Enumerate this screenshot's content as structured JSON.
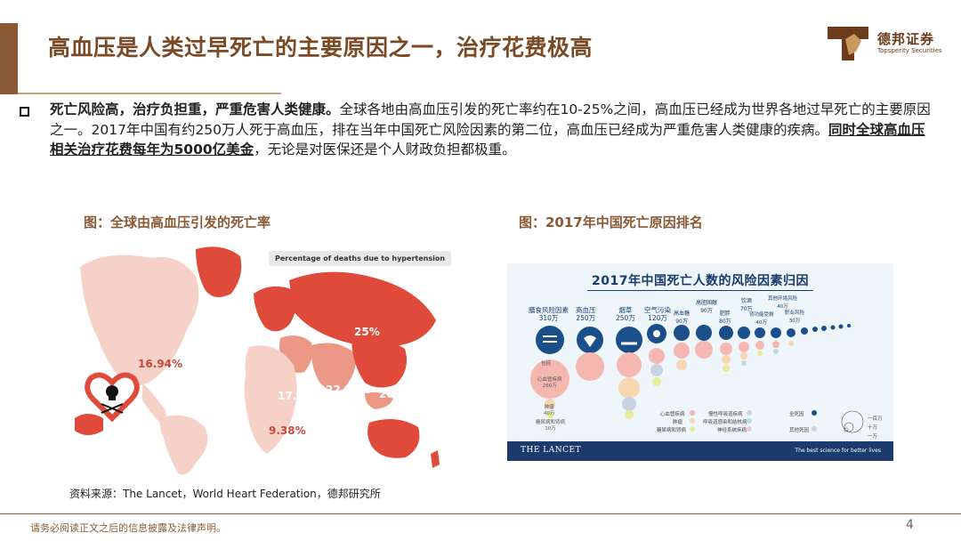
{
  "header": {
    "title": "高血压是人类过早死亡的主要原因之一，治疗花费极高",
    "logo_cn": "德邦证券",
    "logo_en": "Topsperity Securities"
  },
  "body": {
    "bold_lead": "死亡风险高，治疗负担重，严重危害人类健康。",
    "text_1": "全球各地由高血压引发的死亡率约在10-25%之间，高血压已经成为世界各地过早死亡的主要原因之一。2017年中国有约250万人死于高血压，排在当年中国死亡风险因素的第二位，高血压已经成为严重危害人类健康的疾病。",
    "underlined": "同时全球高血压相关治疗花费每年为5000亿美金",
    "text_2": "，无论是对医保还是个人财政负担都极重。"
  },
  "figure_left": {
    "caption": "图：全球由高血压引发的死亡率",
    "legend_label": "Percentage of deaths due to hypertension",
    "regions": [
      {
        "name": "north-america",
        "value": "16.94%"
      },
      {
        "name": "north-asia",
        "value": "25%"
      },
      {
        "name": "middle-east",
        "value": "17.81%"
      },
      {
        "name": "south-asia",
        "value": "22.51%"
      },
      {
        "name": "east-asia",
        "value": "20.99%"
      },
      {
        "name": "africa",
        "value": "9.38%"
      }
    ],
    "colors": {
      "light": "#f6d1c7",
      "mid": "#ec9886",
      "dark": "#e04a3b"
    }
  },
  "figure_right": {
    "caption": "图：2017年中国死亡原因排名",
    "chart_title": "2017年中国死亡人数的风险因素归因",
    "brand": "THE LANCET",
    "tagline": "The best science for better lives",
    "risks": [
      {
        "label": "膳食风险因素",
        "value": "310万"
      },
      {
        "label": "高血压",
        "value": "250万"
      },
      {
        "label": "烟草",
        "value": "250万"
      },
      {
        "label": "空气污染",
        "value": "120万"
      },
      {
        "label": "高血糖",
        "value": "90万"
      },
      {
        "label": "高胆固醇",
        "value": "90万"
      },
      {
        "label": "肥胖",
        "value": "80万"
      },
      {
        "label": "饮酒",
        "value": "70万"
      },
      {
        "label": "肾功能受损",
        "value": "40万"
      },
      {
        "label": "其他环境风险",
        "value": "40万"
      },
      {
        "label": "职业风险",
        "value": "30万"
      }
    ],
    "includes_label": "包括",
    "sub_causes": [
      {
        "label": "心血管疾病",
        "value": "260万"
      },
      {
        "label": "肿瘤",
        "value": "40万"
      },
      {
        "label": "糖尿病和肾病",
        "value": "10万"
      }
    ],
    "legend": {
      "cardio": "心血管疾病",
      "cancer": "肿瘤",
      "diabetes": "糖尿病和肾病",
      "respiratory": "慢性呼吸道疾病",
      "digestive": "呼吸道感染和结核病",
      "neuro": "神经系统疾病",
      "all_causes": "全死因",
      "other": "其他死因"
    },
    "scale": {
      "big": "一百万",
      "mid": "十万",
      "small": "一万"
    }
  },
  "source": "资料来源：The Lancet，World Heart Federation，德邦研究所",
  "footer": {
    "disclaimer": "请务必阅读正文之后的信息披露及法律声明。",
    "page": "4"
  }
}
